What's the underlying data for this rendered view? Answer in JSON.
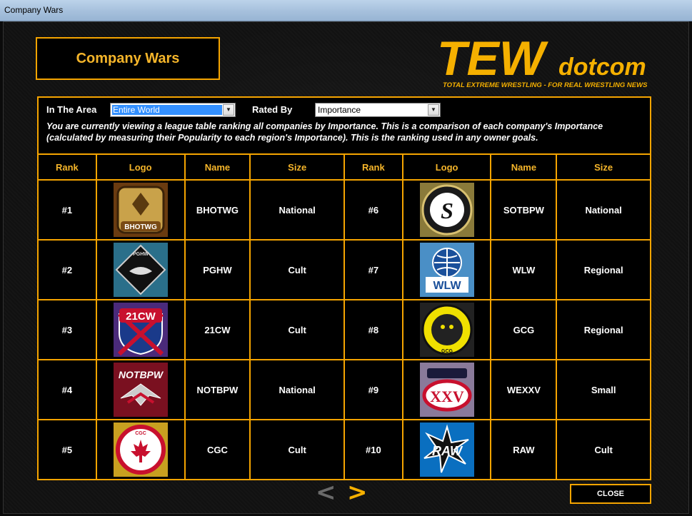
{
  "window": {
    "title": "Company Wars"
  },
  "header": {
    "title": "Company Wars"
  },
  "brand": {
    "main": "TEW",
    "suffix": "dotcom",
    "tagline": "TOTAL EXTREME WRESTLING - FOR REAL WRESTLING NEWS",
    "color": "#f5b000"
  },
  "filters": {
    "area_label": "In The Area",
    "area_value": "Entire World",
    "rated_label": "Rated By",
    "rated_value": "Importance",
    "description": "You are currently viewing a league table ranking all companies by Importance. This is a comparison of each company's Importance (calculated by measuring their Popularity to each region's Importance). This is the ranking used in any owner goals."
  },
  "table": {
    "headers": [
      "Rank",
      "Logo",
      "Name",
      "Size",
      "Rank",
      "Logo",
      "Name",
      "Size"
    ],
    "rows": [
      {
        "left": {
          "rank": "#1",
          "logo_text": "BHOTWG",
          "name": "BHOTWG",
          "size": "National"
        },
        "right": {
          "rank": "#6",
          "logo_text": "S",
          "name": "SOTBPW",
          "size": "National"
        }
      },
      {
        "left": {
          "rank": "#2",
          "logo_text": "PGHW",
          "name": "PGHW",
          "size": "Cult"
        },
        "right": {
          "rank": "#7",
          "logo_text": "WLW",
          "name": "WLW",
          "size": "Regional"
        }
      },
      {
        "left": {
          "rank": "#3",
          "logo_text": "21CW",
          "name": "21CW",
          "size": "Cult"
        },
        "right": {
          "rank": "#8",
          "logo_text": "GCG",
          "name": "GCG",
          "size": "Regional"
        }
      },
      {
        "left": {
          "rank": "#4",
          "logo_text": "NOTBPW",
          "name": "NOTBPW",
          "size": "National"
        },
        "right": {
          "rank": "#9",
          "logo_text": "XXV",
          "name": "WEXXV",
          "size": "Small"
        }
      },
      {
        "left": {
          "rank": "#5",
          "logo_text": "CGC",
          "name": "CGC",
          "size": "Cult"
        },
        "right": {
          "rank": "#10",
          "logo_text": "RAW",
          "name": "RAW",
          "size": "Cult"
        }
      }
    ]
  },
  "nav": {
    "prev": "<",
    "next": ">"
  },
  "close_label": "CLOSE",
  "colors": {
    "accent": "#f5a400",
    "header_text": "#f5b52a"
  }
}
